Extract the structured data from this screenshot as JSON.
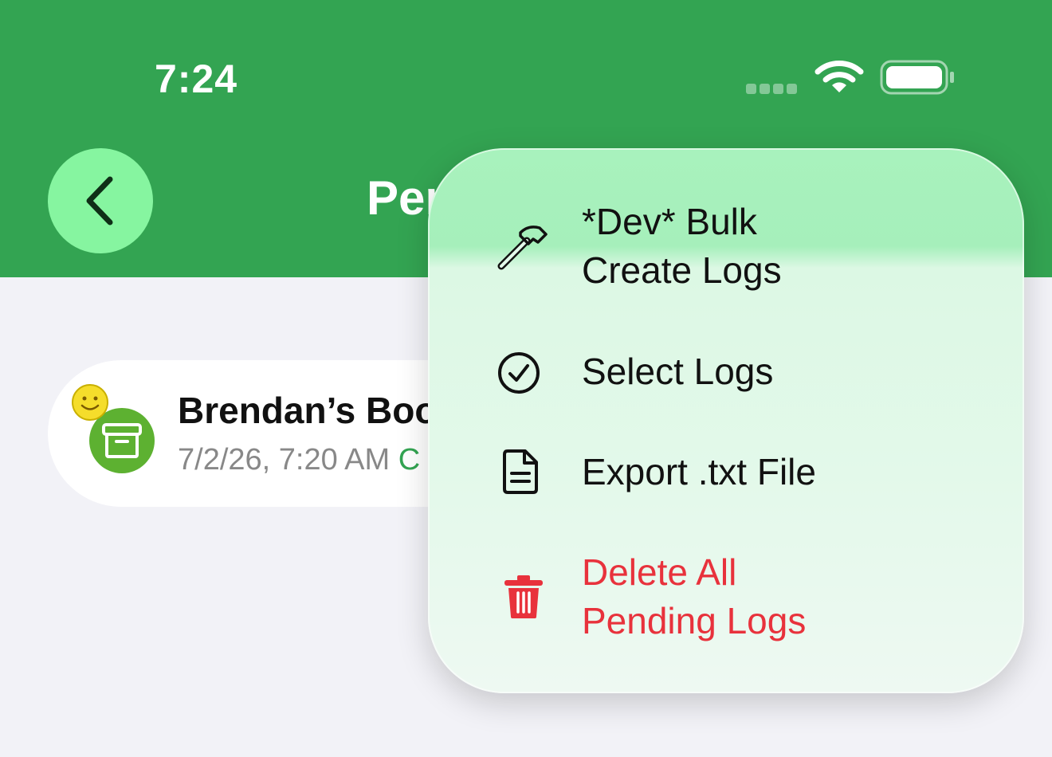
{
  "status_bar": {
    "time": "7:24",
    "wifi_icon": "wifi-icon",
    "battery_icon": "battery-icon"
  },
  "nav": {
    "back_icon": "chevron-left-icon",
    "title": "Per"
  },
  "log": {
    "title": "Brendan’s Boo",
    "timestamp": "7/2/26, 7:20 AM",
    "status_initial": "C",
    "icon": "archive-box-icon",
    "badge": "smiley-icon"
  },
  "menu": {
    "items": [
      {
        "line1": "*Dev* Bulk",
        "line2": "Create Logs",
        "icon": "hammer-icon"
      },
      {
        "line1": "Select Logs",
        "icon": "checkmark-circle-icon"
      },
      {
        "line1": "Export .txt File",
        "icon": "document-icon"
      },
      {
        "line1": "Delete All",
        "line2": "Pending Logs",
        "icon": "trash-icon",
        "color": "#e8323c"
      }
    ]
  },
  "colors": {
    "header": "#33a452",
    "back_button": "#86f5a0",
    "background": "#f2f2f7",
    "danger": "#e8323c"
  }
}
